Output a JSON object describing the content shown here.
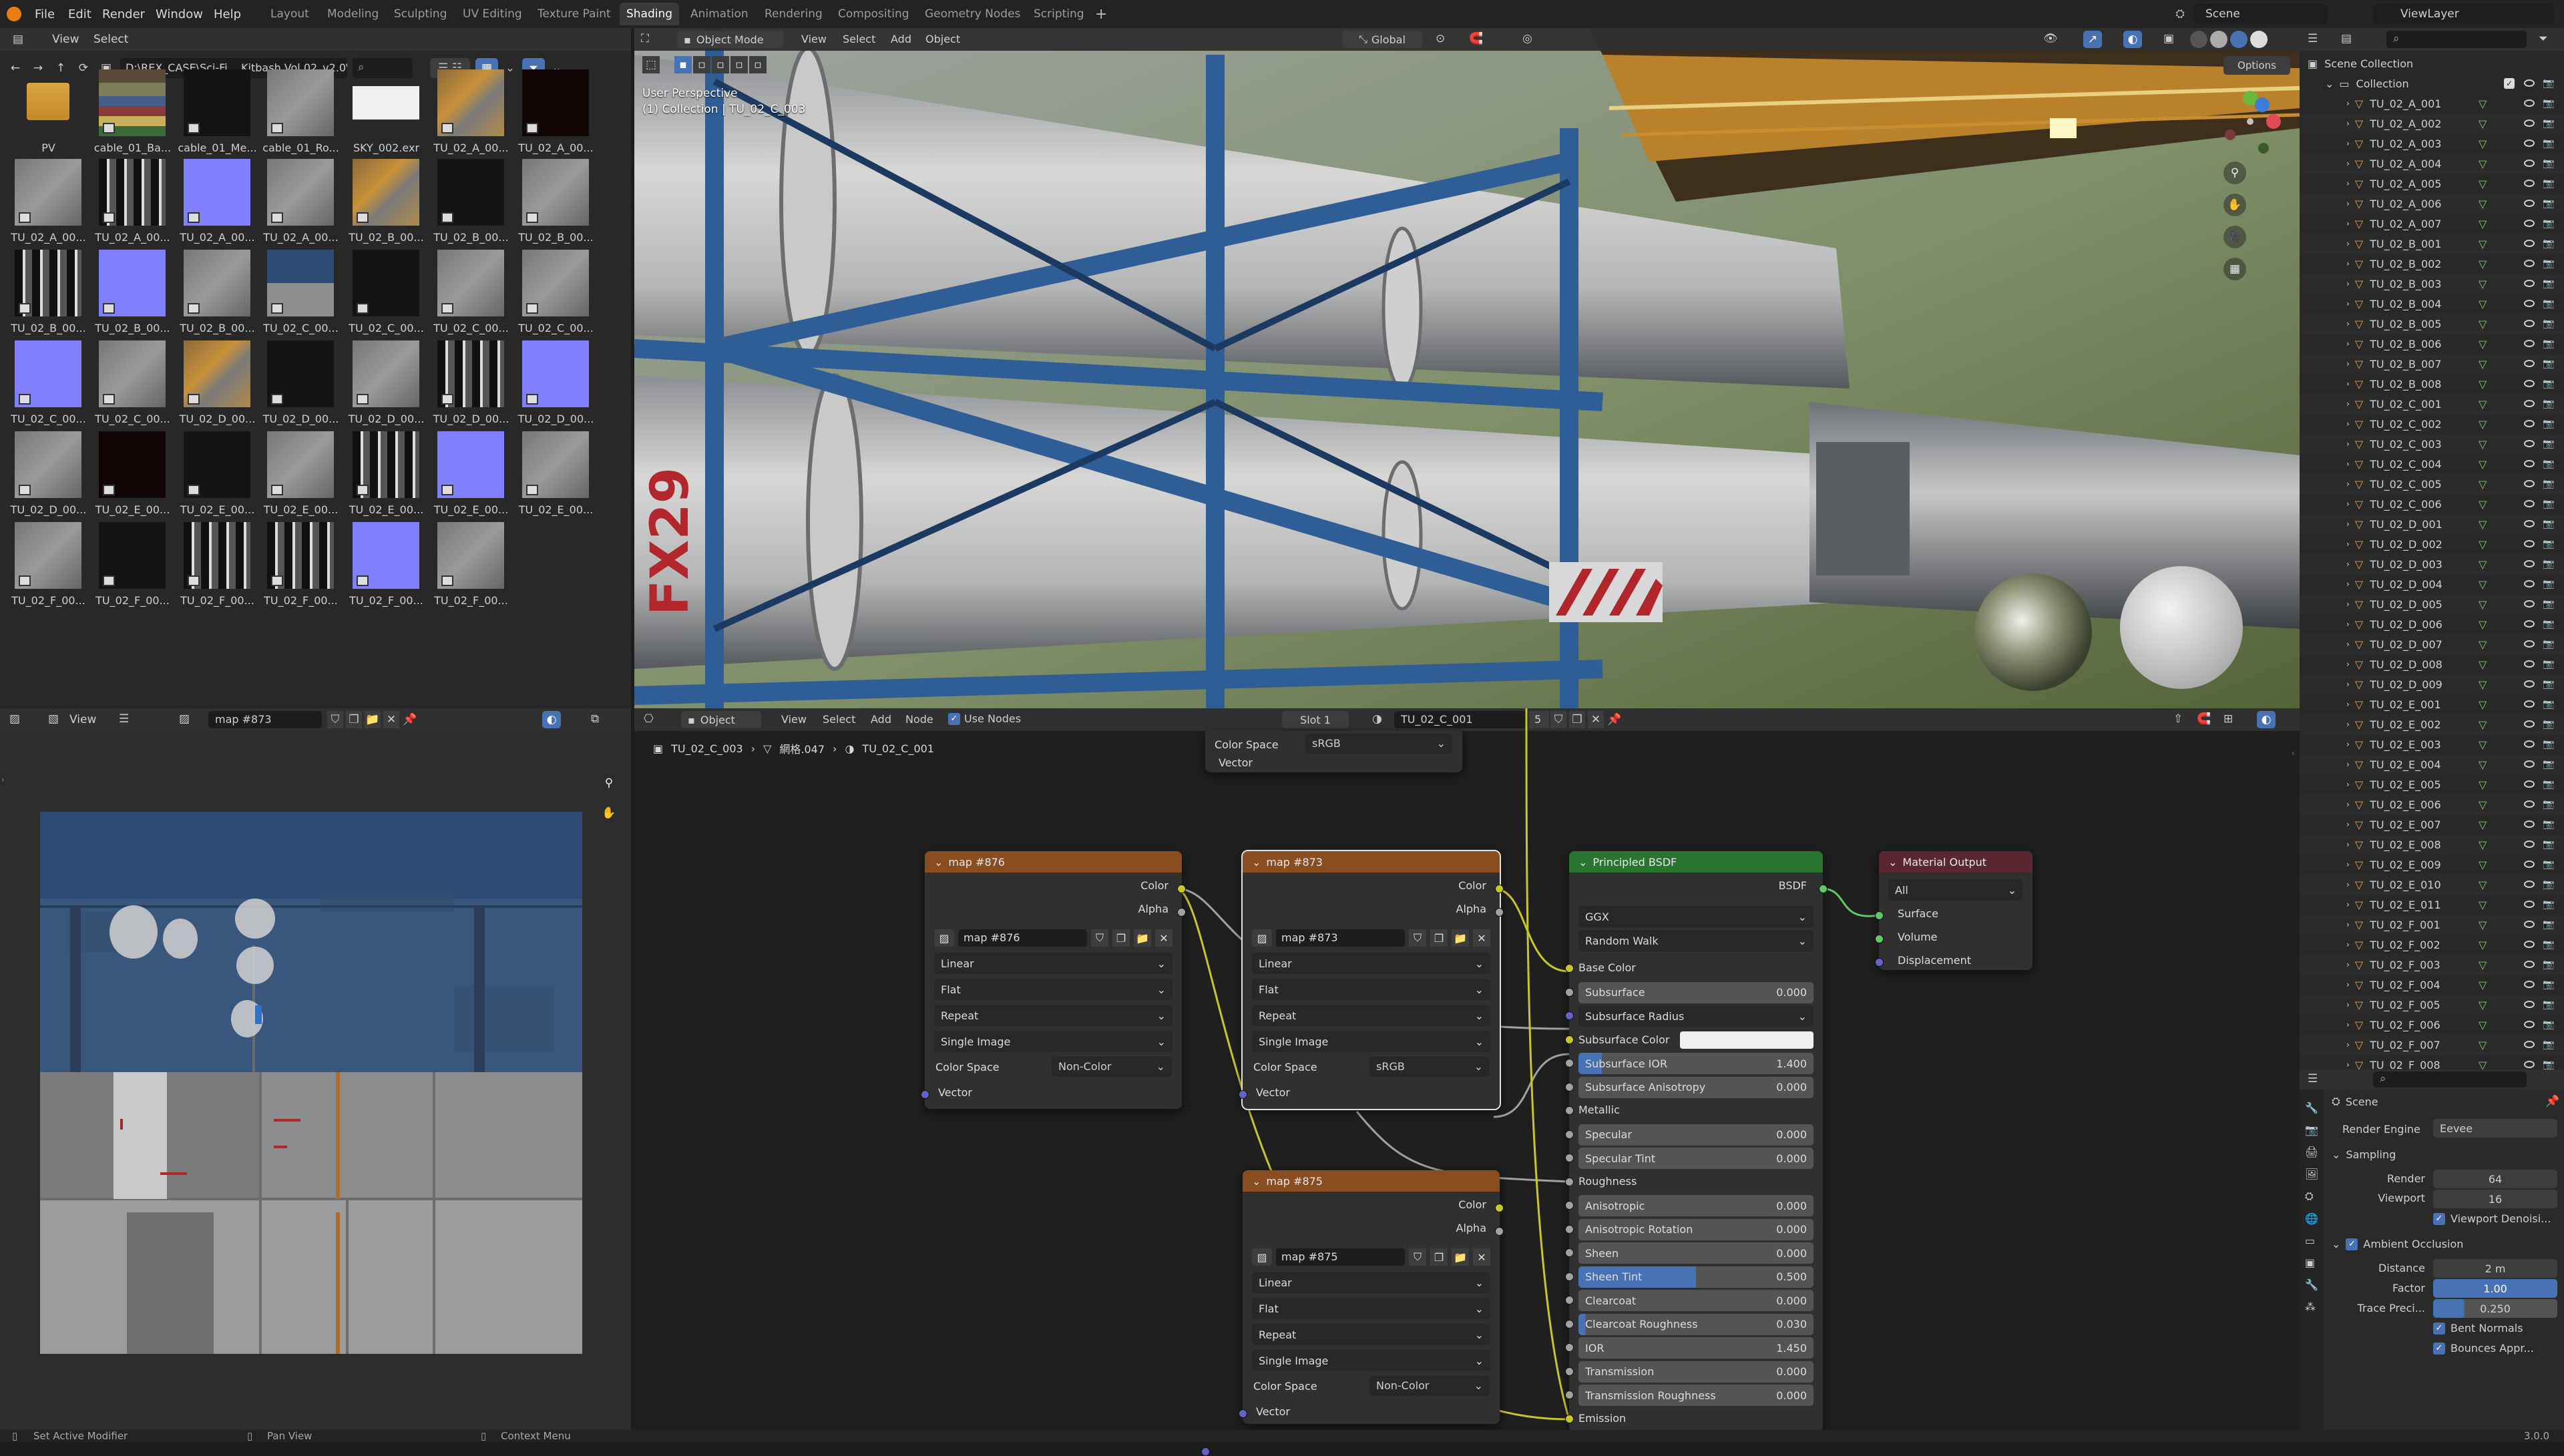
{
  "topbar": {
    "menus": [
      "File",
      "Edit",
      "Render",
      "Window",
      "Help"
    ],
    "workspaces": [
      "Layout",
      "Modeling",
      "Sculpting",
      "UV Editing",
      "Texture Paint",
      "Shading",
      "Animation",
      "Rendering",
      "Compositing",
      "Geometry Nodes",
      "Scripting"
    ],
    "active_workspace": "Shading",
    "scene_label": "Scene",
    "viewlayer_label": "ViewLayer"
  },
  "file_browser": {
    "menu_view": "View",
    "menu_select": "Select",
    "path": "D:\\REX_CASE\\Sci-Fi ...Kitbash Vol 02_v2.0\\",
    "items": [
      {
        "label": "PV",
        "kind": "folder"
      },
      {
        "label": "cable_01_Ba...",
        "kind": "color"
      },
      {
        "label": "cable_01_Me...",
        "kind": "dark"
      },
      {
        "label": "cable_01_Ro...",
        "kind": "gray"
      },
      {
        "label": "SKY_002.exr",
        "kind": "white"
      },
      {
        "label": "TU_02_A_00...",
        "kind": "rust"
      },
      {
        "label": "TU_02_A_00...",
        "kind": "darkred"
      },
      {
        "label": "TU_02_A_00...",
        "kind": "gray"
      },
      {
        "label": "TU_02_A_00...",
        "kind": "bw"
      },
      {
        "label": "TU_02_A_00...",
        "kind": "normal"
      },
      {
        "label": "TU_02_A_00...",
        "kind": "gray"
      },
      {
        "label": "TU_02_B_00...",
        "kind": "rust"
      },
      {
        "label": "TU_02_B_00...",
        "kind": "dark"
      },
      {
        "label": "TU_02_B_00...",
        "kind": "gray"
      },
      {
        "label": "TU_02_B_00...",
        "kind": "bw"
      },
      {
        "label": "TU_02_B_00...",
        "kind": "normal"
      },
      {
        "label": "TU_02_B_00...",
        "kind": "gray"
      },
      {
        "label": "TU_02_C_00...",
        "kind": "blue"
      },
      {
        "label": "TU_02_C_00...",
        "kind": "dark"
      },
      {
        "label": "TU_02_C_00...",
        "kind": "gray"
      },
      {
        "label": "TU_02_C_00...",
        "kind": "gray"
      },
      {
        "label": "TU_02_C_00...",
        "kind": "normal"
      },
      {
        "label": "TU_02_C_00...",
        "kind": "gray"
      },
      {
        "label": "TU_02_D_00...",
        "kind": "rust"
      },
      {
        "label": "TU_02_D_00...",
        "kind": "dark"
      },
      {
        "label": "TU_02_D_00...",
        "kind": "gray"
      },
      {
        "label": "TU_02_D_00...",
        "kind": "bw"
      },
      {
        "label": "TU_02_D_00...",
        "kind": "normal"
      },
      {
        "label": "TU_02_D_00...",
        "kind": "gray"
      },
      {
        "label": "TU_02_E_00...",
        "kind": "darkred"
      },
      {
        "label": "TU_02_E_00...",
        "kind": "dark"
      },
      {
        "label": "TU_02_E_00...",
        "kind": "gray"
      },
      {
        "label": "TU_02_E_00...",
        "kind": "bw"
      },
      {
        "label": "TU_02_E_00...",
        "kind": "normal"
      },
      {
        "label": "TU_02_E_00...",
        "kind": "gray"
      },
      {
        "label": "TU_02_F_00...",
        "kind": "gray"
      },
      {
        "label": "TU_02_F_00...",
        "kind": "dark"
      },
      {
        "label": "TU_02_F_00...",
        "kind": "bw"
      },
      {
        "label": "TU_02_F_00...",
        "kind": "bw"
      },
      {
        "label": "TU_02_F_00...",
        "kind": "normal"
      },
      {
        "label": "TU_02_F_00...",
        "kind": "gray"
      }
    ]
  },
  "viewport": {
    "mode": "Object Mode",
    "menus": [
      "View",
      "Select",
      "Add",
      "Object"
    ],
    "orientation": "Global",
    "options_label": "Options",
    "overlay_title": "User Perspective",
    "overlay_subtitle": "(1) Collection | TU_02_C_003",
    "decal_text": "FX29"
  },
  "image_editor": {
    "menu_view": "View",
    "image_name": "map #873"
  },
  "node_editor": {
    "object_menu": "Object",
    "menus": [
      "View",
      "Select",
      "Add",
      "Node"
    ],
    "use_nodes": "Use Nodes",
    "slot": "Slot 1",
    "material": "TU_02_C_001",
    "users": "5",
    "breadcrumb": [
      "TU_02_C_003",
      "網格.047",
      "TU_02_C_001"
    ],
    "top_partial": {
      "color_space_label": "Color Space",
      "color_space": "sRGB",
      "vector": "Vector"
    },
    "image_nodes": [
      {
        "title": "map #876",
        "image": "map #876",
        "interp": "Linear",
        "proj": "Flat",
        "ext": "Repeat",
        "source": "Single Image",
        "cs_label": "Color Space",
        "cs": "Non-Color",
        "out_color": "Color",
        "out_alpha": "Alpha",
        "in_vector": "Vector"
      },
      {
        "title": "map #873",
        "image": "map #873",
        "interp": "Linear",
        "proj": "Flat",
        "ext": "Repeat",
        "source": "Single Image",
        "cs_label": "Color Space",
        "cs": "sRGB",
        "out_color": "Color",
        "out_alpha": "Alpha",
        "in_vector": "Vector"
      },
      {
        "title": "map #875",
        "image": "map #875",
        "interp": "Linear",
        "proj": "Flat",
        "ext": "Repeat",
        "source": "Single Image",
        "cs_label": "Color Space",
        "cs": "Non-Color",
        "out_color": "Color",
        "out_alpha": "Alpha",
        "in_vector": "Vector"
      }
    ],
    "bsdf": {
      "title": "Principled BSDF",
      "output": "BSDF",
      "distribution": "GGX",
      "sss_method": "Random Walk",
      "rows": [
        {
          "label": "Base Color",
          "kind": "socket"
        },
        {
          "label": "Subsurface",
          "value": "0.000",
          "kind": "value"
        },
        {
          "label": "Subsurface Radius",
          "kind": "dropdown"
        },
        {
          "label": "Subsurface Color",
          "kind": "color"
        },
        {
          "label": "Subsurface IOR",
          "value": "1.400",
          "kind": "value",
          "fill": 0.1
        },
        {
          "label": "Subsurface Anisotropy",
          "value": "0.000",
          "kind": "value"
        },
        {
          "label": "Metallic",
          "kind": "socket"
        },
        {
          "label": "Specular",
          "value": "0.000",
          "kind": "value"
        },
        {
          "label": "Specular Tint",
          "value": "0.000",
          "kind": "value"
        },
        {
          "label": "Roughness",
          "kind": "socket"
        },
        {
          "label": "Anisotropic",
          "value": "0.000",
          "kind": "value"
        },
        {
          "label": "Anisotropic Rotation",
          "value": "0.000",
          "kind": "value"
        },
        {
          "label": "Sheen",
          "value": "0.000",
          "kind": "value"
        },
        {
          "label": "Sheen Tint",
          "value": "0.500",
          "kind": "value",
          "fill": 0.5
        },
        {
          "label": "Clearcoat",
          "value": "0.000",
          "kind": "value"
        },
        {
          "label": "Clearcoat Roughness",
          "value": "0.030",
          "kind": "value",
          "fill": 0.03
        },
        {
          "label": "IOR",
          "value": "1.450",
          "kind": "value"
        },
        {
          "label": "Transmission",
          "value": "0.000",
          "kind": "value"
        },
        {
          "label": "Transmission Roughness",
          "value": "0.000",
          "kind": "value"
        },
        {
          "label": "Emission",
          "kind": "socket"
        }
      ]
    },
    "output_node": {
      "title": "Material Output",
      "target": "All",
      "inputs": [
        "Surface",
        "Volume",
        "Displacement"
      ]
    }
  },
  "outliner": {
    "scene_collection": "Scene Collection",
    "collection": "Collection",
    "objects": [
      "TU_02_A_001",
      "TU_02_A_002",
      "TU_02_A_003",
      "TU_02_A_004",
      "TU_02_A_005",
      "TU_02_A_006",
      "TU_02_A_007",
      "TU_02_B_001",
      "TU_02_B_002",
      "TU_02_B_003",
      "TU_02_B_004",
      "TU_02_B_005",
      "TU_02_B_006",
      "TU_02_B_007",
      "TU_02_B_008",
      "TU_02_C_001",
      "TU_02_C_002",
      "TU_02_C_003",
      "TU_02_C_004",
      "TU_02_C_005",
      "TU_02_C_006",
      "TU_02_D_001",
      "TU_02_D_002",
      "TU_02_D_003",
      "TU_02_D_004",
      "TU_02_D_005",
      "TU_02_D_006",
      "TU_02_D_007",
      "TU_02_D_008",
      "TU_02_D_009",
      "TU_02_E_001",
      "TU_02_E_002",
      "TU_02_E_003",
      "TU_02_E_004",
      "TU_02_E_005",
      "TU_02_E_006",
      "TU_02_E_007",
      "TU_02_E_008",
      "TU_02_E_009",
      "TU_02_E_010",
      "TU_02_E_011",
      "TU_02_F_001",
      "TU_02_F_002",
      "TU_02_F_003",
      "TU_02_F_004",
      "TU_02_F_005",
      "TU_02_F_006",
      "TU_02_F_007",
      "TU_02_F_008"
    ]
  },
  "properties": {
    "scene": "Scene",
    "render_engine_label": "Render Engine",
    "render_engine": "Eevee",
    "sampling": "Sampling",
    "render_label": "Render",
    "render_value": "64",
    "viewport_label": "Viewport",
    "viewport_value": "16",
    "viewport_denoise": "Viewport Denoisi...",
    "ao": "Ambient Occlusion",
    "distance_label": "Distance",
    "distance_value": "2 m",
    "factor_label": "Factor",
    "factor_value": "1.00",
    "trace_label": "Trace Preci...",
    "trace_value": "0.250",
    "bent_normals": "Bent Normals",
    "bounces": "Bounces Appr..."
  },
  "status": {
    "left": "Set Active Modifier",
    "mid": "Pan View",
    "right": "Context Menu",
    "version": "3.0.0"
  }
}
